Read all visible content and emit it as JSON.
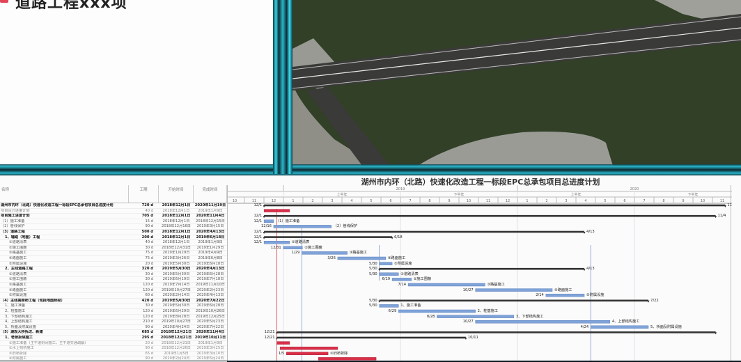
{
  "slide": {
    "title": "道路工程xxx项"
  },
  "gantt": {
    "title": "湖州市内环（北路）快速化改造工程一标段EPC总承包项目总进度计划",
    "columns": {
      "name": "名称",
      "duration": "工期",
      "start": "开始时间",
      "end": "完成时间"
    },
    "years": [
      "2019",
      "2020"
    ],
    "halves": [
      "上半年",
      "下半年",
      "上半年",
      "下半年"
    ],
    "months": [
      "10",
      "11",
      "12",
      "1",
      "2",
      "3",
      "4",
      "5",
      "6",
      "7",
      "8",
      "9",
      "10",
      "11",
      "12",
      "1",
      "2",
      "3",
      "4",
      "5",
      "6",
      "7",
      "8",
      "9",
      "10",
      "11"
    ],
    "axis_start": "2018-10-01",
    "colors": {
      "task": "#7fa3d8",
      "critical": "#d9304a",
      "summary": "#333333"
    },
    "rows": [
      {
        "name": "湖州市内环（北路）快速化改造工程一标段EPC总承包项目总进度计划",
        "dur": "720 d",
        "start": "2018年12月1日",
        "end": "2020年11月19日",
        "type": "summary",
        "sl": "12/1",
        "el": "11"
      },
      {
        "name": "项目设计进度计划",
        "dur": "40 d",
        "start": "2018年12月1日",
        "end": "2019年1月9日",
        "type": "critical",
        "sl": "",
        "el": ""
      },
      {
        "name": "项目施工进度计划",
        "dur": "705 d",
        "start": "2018年12月1日",
        "end": "2020年11月4日",
        "type": "summary",
        "sl": "12/1",
        "el": "11/4"
      },
      {
        "name": "（1）施工准备",
        "dur": "15 d",
        "start": "2018年12月1日",
        "end": "2018年12月15日",
        "type": "task",
        "sl": "12/1",
        "el": "（1）施工准备"
      },
      {
        "name": "（2）管线保护",
        "dur": "90 d",
        "start": "2018年12月16日",
        "end": "2019年3月15日",
        "type": "task",
        "sl": "12/16",
        "el": "（2）管线保护"
      },
      {
        "name": "（3）道路工程",
        "dur": "500 d",
        "start": "2018年12月1日",
        "end": "2020年4月13日",
        "type": "summary",
        "sl": "12/1",
        "el": "4/13"
      },
      {
        "name": "1、辅路（地面）工程",
        "dur": "200 d",
        "start": "2018年12月1日",
        "end": "2019年6月18日",
        "type": "summary",
        "sl": "12/1",
        "el": "6/18"
      },
      {
        "name": "①道路清表",
        "dur": "40 d",
        "start": "2018年12月1日",
        "end": "2019年1月9日",
        "type": "task",
        "sl": "12/1",
        "el": "①道路清表"
      },
      {
        "name": "②施工围蔽",
        "dur": "30 d",
        "start": "2018年12月31日",
        "end": "2019年1月29日",
        "type": "task",
        "sl": "12/31",
        "el": "②施工围蔽"
      },
      {
        "name": "③路基施工",
        "dur": "75 d",
        "start": "2019年1月29日",
        "end": "2019年4月9日",
        "type": "task",
        "sl": "1/29",
        "el": "③路基施工"
      },
      {
        "name": "④路面施工",
        "dur": "75 d",
        "start": "2019年3月26日",
        "end": "2019年6月8日",
        "type": "task",
        "sl": "3/26",
        "el": "④路面施工"
      },
      {
        "name": "⑤附属设施",
        "dur": "20 d",
        "start": "2019年5月30日",
        "end": "2019年6月18日",
        "type": "task",
        "sl": "5/30",
        "el": "⑤附属设施"
      },
      {
        "name": "2、主线道路工程",
        "dur": "320 d",
        "start": "2019年5月30日",
        "end": "2020年4月13日",
        "type": "summary",
        "sl": "5/30",
        "el": "4/13"
      },
      {
        "name": "①道路清表",
        "dur": "30 d",
        "start": "2019年5月30日",
        "end": "2019年6月28日",
        "type": "task",
        "sl": "5/30",
        "el": "①道路清表"
      },
      {
        "name": "②施工围蔽",
        "dur": "30 d",
        "start": "2019年6月19日",
        "end": "2019年7月18日",
        "type": "task",
        "sl": "6/19",
        "el": "②施工围蔽"
      },
      {
        "name": "③路基施工",
        "dur": "120 d",
        "start": "2019年7月14日",
        "end": "2019年11月10日",
        "type": "task",
        "sl": "7/14",
        "el": "③路基施工"
      },
      {
        "name": "④路面施工",
        "dur": "120 d",
        "start": "2019年10月27日",
        "end": "2020年2月23日",
        "type": "task",
        "sl": "10/27",
        "el": "④路面施工"
      },
      {
        "name": "⑤附属设施",
        "dur": "60 d",
        "start": "2020年2月14日",
        "end": "2020年4月13日",
        "type": "task",
        "sl": "2/14",
        "el": "⑤附属设施"
      },
      {
        "name": "（4）主线高架桥工程（包括地面桥梁）",
        "dur": "420 d",
        "start": "2019年5月30日",
        "end": "2020年7月22日",
        "type": "summary",
        "sl": "5/30",
        "el": "7/22"
      },
      {
        "name": "1、施工准备",
        "dur": "30 d",
        "start": "2019年5月30日",
        "end": "2019年6月28日",
        "type": "task",
        "sl": "5/30",
        "el": "1、施工准备"
      },
      {
        "name": "2、桩基施工",
        "dur": "120 d",
        "start": "2019年6月29日",
        "end": "2019年10月26日",
        "type": "task",
        "sl": "6/29",
        "el": "2、桩基施工"
      },
      {
        "name": "3、下部结构施工",
        "dur": "120 d",
        "start": "2019年8月28日",
        "end": "2019年12月25日",
        "type": "task",
        "sl": "8/28",
        "el": "3、下部结构施工"
      },
      {
        "name": "4、上部结构施工",
        "dur": "210 d",
        "start": "2019年10月27日",
        "end": "2020年5月23日",
        "type": "task",
        "sl": "10/27",
        "el": "4、上部结构施工"
      },
      {
        "name": "5、桥面及附属设施",
        "dur": "90 d",
        "start": "2020年4月24日",
        "end": "2020年7月22日",
        "type": "task",
        "sl": "4/24",
        "el": "5、桥面及附属设施"
      },
      {
        "name": "（5）湖观大桥拆改、新建",
        "dur": "685 d",
        "start": "2018年12月21日",
        "end": "2020年11月4日",
        "type": "summary",
        "sl": "12/21",
        "el": ""
      },
      {
        "name": "1、老桥拆除施工",
        "dur": "295 d",
        "start": "2018年12月21日",
        "end": "2019年10月11日",
        "type": "summary",
        "sl": "12/21",
        "el": "10/11"
      },
      {
        "name": "①施工准备（主干道封闭施工，主干道交通疏解）",
        "dur": "20 d",
        "start": "2018年12月21日",
        "end": "2019年1月9日",
        "type": "critical",
        "sl": "",
        "el": ""
      },
      {
        "name": "②水上栈桥施工",
        "dur": "90 d",
        "start": "2018年12月26日",
        "end": "2019年3月25日",
        "type": "critical",
        "sl": "",
        "el": ""
      },
      {
        "name": "③旧桥拆除",
        "dur": "65 d",
        "start": "2019年1月5日",
        "end": "2019年3月10日",
        "type": "critical",
        "sl": "1/5",
        "el": "③旧桥拆除"
      },
      {
        "name": "④附属施工",
        "dur": "90 d",
        "start": "2019年2月24日",
        "end": "2019年5月24日",
        "type": "critical",
        "sl": "",
        "el": ""
      }
    ]
  }
}
